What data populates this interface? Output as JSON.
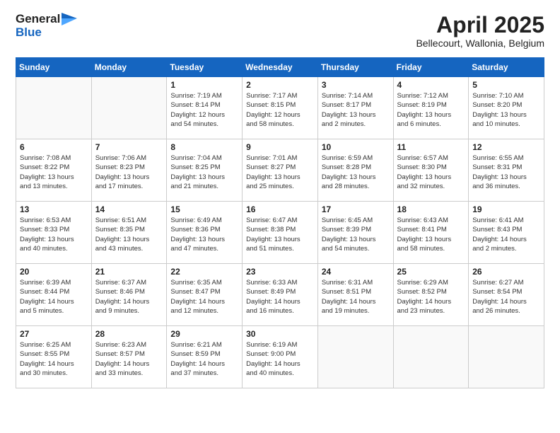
{
  "header": {
    "logo_general": "General",
    "logo_blue": "Blue",
    "title": "April 2025",
    "location": "Bellecourt, Wallonia, Belgium"
  },
  "weekdays": [
    "Sunday",
    "Monday",
    "Tuesday",
    "Wednesday",
    "Thursday",
    "Friday",
    "Saturday"
  ],
  "weeks": [
    [
      {
        "day": "",
        "info": ""
      },
      {
        "day": "",
        "info": ""
      },
      {
        "day": "1",
        "info": "Sunrise: 7:19 AM\nSunset: 8:14 PM\nDaylight: 12 hours\nand 54 minutes."
      },
      {
        "day": "2",
        "info": "Sunrise: 7:17 AM\nSunset: 8:15 PM\nDaylight: 12 hours\nand 58 minutes."
      },
      {
        "day": "3",
        "info": "Sunrise: 7:14 AM\nSunset: 8:17 PM\nDaylight: 13 hours\nand 2 minutes."
      },
      {
        "day": "4",
        "info": "Sunrise: 7:12 AM\nSunset: 8:19 PM\nDaylight: 13 hours\nand 6 minutes."
      },
      {
        "day": "5",
        "info": "Sunrise: 7:10 AM\nSunset: 8:20 PM\nDaylight: 13 hours\nand 10 minutes."
      }
    ],
    [
      {
        "day": "6",
        "info": "Sunrise: 7:08 AM\nSunset: 8:22 PM\nDaylight: 13 hours\nand 13 minutes."
      },
      {
        "day": "7",
        "info": "Sunrise: 7:06 AM\nSunset: 8:23 PM\nDaylight: 13 hours\nand 17 minutes."
      },
      {
        "day": "8",
        "info": "Sunrise: 7:04 AM\nSunset: 8:25 PM\nDaylight: 13 hours\nand 21 minutes."
      },
      {
        "day": "9",
        "info": "Sunrise: 7:01 AM\nSunset: 8:27 PM\nDaylight: 13 hours\nand 25 minutes."
      },
      {
        "day": "10",
        "info": "Sunrise: 6:59 AM\nSunset: 8:28 PM\nDaylight: 13 hours\nand 28 minutes."
      },
      {
        "day": "11",
        "info": "Sunrise: 6:57 AM\nSunset: 8:30 PM\nDaylight: 13 hours\nand 32 minutes."
      },
      {
        "day": "12",
        "info": "Sunrise: 6:55 AM\nSunset: 8:31 PM\nDaylight: 13 hours\nand 36 minutes."
      }
    ],
    [
      {
        "day": "13",
        "info": "Sunrise: 6:53 AM\nSunset: 8:33 PM\nDaylight: 13 hours\nand 40 minutes."
      },
      {
        "day": "14",
        "info": "Sunrise: 6:51 AM\nSunset: 8:35 PM\nDaylight: 13 hours\nand 43 minutes."
      },
      {
        "day": "15",
        "info": "Sunrise: 6:49 AM\nSunset: 8:36 PM\nDaylight: 13 hours\nand 47 minutes."
      },
      {
        "day": "16",
        "info": "Sunrise: 6:47 AM\nSunset: 8:38 PM\nDaylight: 13 hours\nand 51 minutes."
      },
      {
        "day": "17",
        "info": "Sunrise: 6:45 AM\nSunset: 8:39 PM\nDaylight: 13 hours\nand 54 minutes."
      },
      {
        "day": "18",
        "info": "Sunrise: 6:43 AM\nSunset: 8:41 PM\nDaylight: 13 hours\nand 58 minutes."
      },
      {
        "day": "19",
        "info": "Sunrise: 6:41 AM\nSunset: 8:43 PM\nDaylight: 14 hours\nand 2 minutes."
      }
    ],
    [
      {
        "day": "20",
        "info": "Sunrise: 6:39 AM\nSunset: 8:44 PM\nDaylight: 14 hours\nand 5 minutes."
      },
      {
        "day": "21",
        "info": "Sunrise: 6:37 AM\nSunset: 8:46 PM\nDaylight: 14 hours\nand 9 minutes."
      },
      {
        "day": "22",
        "info": "Sunrise: 6:35 AM\nSunset: 8:47 PM\nDaylight: 14 hours\nand 12 minutes."
      },
      {
        "day": "23",
        "info": "Sunrise: 6:33 AM\nSunset: 8:49 PM\nDaylight: 14 hours\nand 16 minutes."
      },
      {
        "day": "24",
        "info": "Sunrise: 6:31 AM\nSunset: 8:51 PM\nDaylight: 14 hours\nand 19 minutes."
      },
      {
        "day": "25",
        "info": "Sunrise: 6:29 AM\nSunset: 8:52 PM\nDaylight: 14 hours\nand 23 minutes."
      },
      {
        "day": "26",
        "info": "Sunrise: 6:27 AM\nSunset: 8:54 PM\nDaylight: 14 hours\nand 26 minutes."
      }
    ],
    [
      {
        "day": "27",
        "info": "Sunrise: 6:25 AM\nSunset: 8:55 PM\nDaylight: 14 hours\nand 30 minutes."
      },
      {
        "day": "28",
        "info": "Sunrise: 6:23 AM\nSunset: 8:57 PM\nDaylight: 14 hours\nand 33 minutes."
      },
      {
        "day": "29",
        "info": "Sunrise: 6:21 AM\nSunset: 8:59 PM\nDaylight: 14 hours\nand 37 minutes."
      },
      {
        "day": "30",
        "info": "Sunrise: 6:19 AM\nSunset: 9:00 PM\nDaylight: 14 hours\nand 40 minutes."
      },
      {
        "day": "",
        "info": ""
      },
      {
        "day": "",
        "info": ""
      },
      {
        "day": "",
        "info": ""
      }
    ]
  ]
}
